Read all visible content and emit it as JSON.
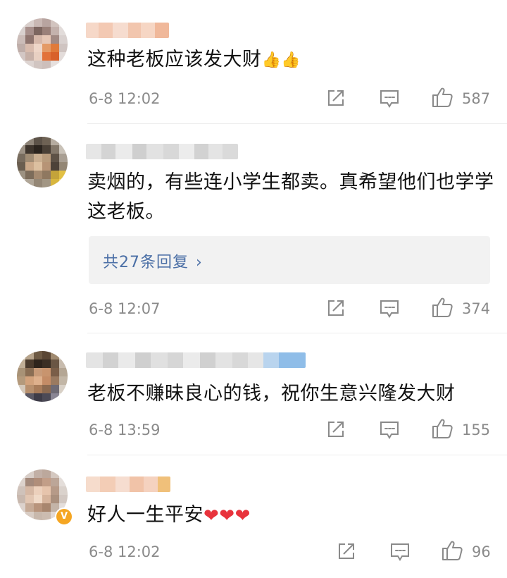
{
  "comments": [
    {
      "text": "这种老板应该发大财",
      "emoji": "👍👍",
      "time": "6-8 12:02",
      "likes": "587",
      "reply_summary": "",
      "verified": false
    },
    {
      "text": "卖烟的，有些连小学生都卖。真希望他们也学学这老板。",
      "emoji": "",
      "time": "6-8 12:07",
      "likes": "374",
      "reply_summary": "共27条回复",
      "verified": false
    },
    {
      "text": "老板不赚昧良心的钱，祝你生意兴隆发大财",
      "emoji": "",
      "time": "6-8 13:59",
      "likes": "155",
      "reply_summary": "",
      "verified": false
    },
    {
      "text": "好人一生平安",
      "emoji": "❤❤❤",
      "time": "6-8 12:02",
      "likes": "96",
      "reply_summary": "",
      "verified": true
    }
  ],
  "icons": {
    "share": "share-icon",
    "comment": "comment-icon",
    "like": "thumbs-up-icon",
    "reply_chevron": "chevron-right-icon",
    "verified": "verified-v-badge-icon"
  },
  "colors": {
    "reply_link": "#4b6fa6",
    "meta_gray": "#8a8a8a",
    "reply_bg": "#f2f2f2",
    "heart": "#e8333c",
    "verified_badge": "#f5a623"
  },
  "verified_badge_label": "V"
}
